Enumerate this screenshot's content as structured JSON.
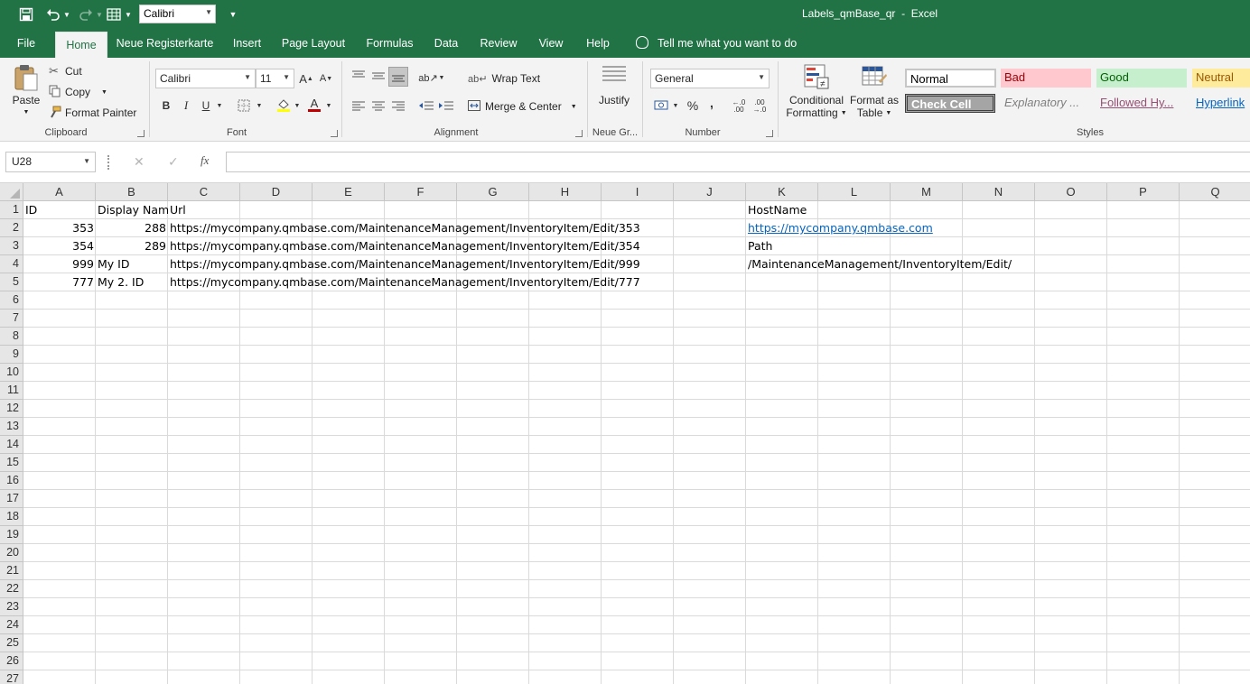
{
  "window": {
    "title": "Labels_qmBase_qr  -  Excel"
  },
  "qat": {
    "font": "Calibri"
  },
  "tabs": [
    {
      "label": "File"
    },
    {
      "label": "Home"
    },
    {
      "label": "Neue Registerkarte"
    },
    {
      "label": "Insert"
    },
    {
      "label": "Page Layout"
    },
    {
      "label": "Formulas"
    },
    {
      "label": "Data"
    },
    {
      "label": "Review"
    },
    {
      "label": "View"
    },
    {
      "label": "Help"
    }
  ],
  "tellme": "Tell me what you want to do",
  "ribbon": {
    "clipboard": {
      "label": "Clipboard",
      "paste": "Paste",
      "cut": "Cut",
      "copy": "Copy",
      "format_painter": "Format Painter"
    },
    "font": {
      "label": "Font",
      "name": "Calibri",
      "size": "11",
      "bold": "B",
      "italic": "I",
      "underline": "U",
      "font_color": "A"
    },
    "alignment": {
      "label": "Alignment",
      "wrap_text": "Wrap Text",
      "merge_center": "Merge & Center"
    },
    "neue": {
      "label": "Neue Gr...",
      "justify": "Justify"
    },
    "number": {
      "label": "Number",
      "format": "General",
      "percent": "%",
      "comma": ",",
      "inc_decimal": "←.0 .00",
      "dec_decimal": ".00 →.0"
    },
    "styles": {
      "label": "Styles",
      "conditional_1": "Conditional",
      "conditional_2": "Formatting",
      "format_table_1": "Format as",
      "format_table_2": "Table",
      "normal": "Normal",
      "bad": "Bad",
      "good": "Good",
      "neutral": "Neutral",
      "check_cell": "Check Cell",
      "explanatory": "Explanatory ...",
      "followed": "Followed Hy...",
      "hyperlink": "Hyperlink"
    }
  },
  "formula_bar": {
    "name_box": "U28",
    "fx": "fx",
    "cancel": "✕",
    "enter": "✓",
    "value": ""
  },
  "sheet": {
    "columns": [
      "A",
      "B",
      "C",
      "D",
      "E",
      "F",
      "G",
      "H",
      "I",
      "J",
      "K",
      "L",
      "M",
      "N",
      "O",
      "P",
      "Q"
    ],
    "rows": [
      "1",
      "2",
      "3",
      "4",
      "5",
      "6",
      "7",
      "8",
      "9",
      "10",
      "11",
      "12",
      "13",
      "14",
      "15",
      "16",
      "17",
      "18",
      "19",
      "20",
      "21",
      "22",
      "23",
      "24",
      "25",
      "26",
      "27"
    ],
    "cells": {
      "A1": "ID",
      "B1": "Display Nam",
      "C1": "Url",
      "K1": "HostName",
      "A2": "353",
      "B2": "288",
      "C2": "https://mycompany.qmbase.com/MaintenanceManagement/InventoryItem/Edit/353",
      "K2": "https://mycompany.qmbase.com",
      "A3": "354",
      "B3": "289",
      "C3": "https://mycompany.qmbase.com/MaintenanceManagement/InventoryItem/Edit/354",
      "K3": "Path",
      "A4": "999",
      "B4": "My ID",
      "C4": "https://mycompany.qmbase.com/MaintenanceManagement/InventoryItem/Edit/999",
      "K4": "/MaintenanceManagement/InventoryItem/Edit/",
      "A5": "777",
      "B5": "My 2. ID",
      "C5": "https://mycompany.qmbase.com/MaintenanceManagement/InventoryItem/Edit/777"
    }
  }
}
